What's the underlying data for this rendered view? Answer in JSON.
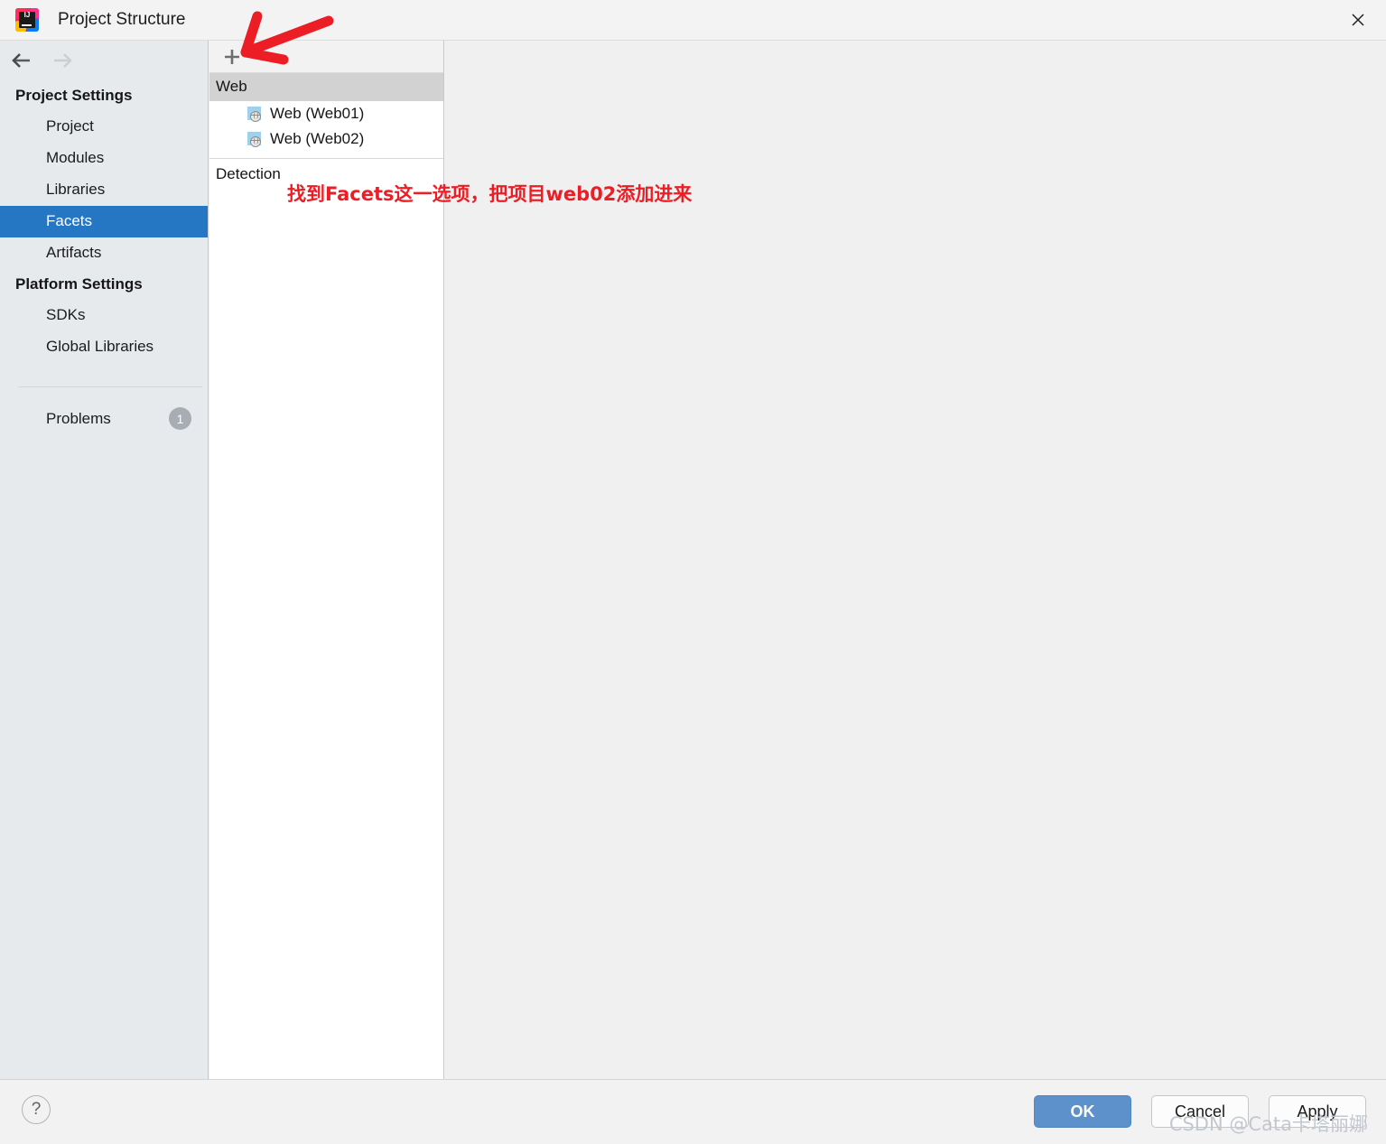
{
  "window": {
    "title": "Project Structure",
    "app_icon": "intellij-idea-icon",
    "icon_text": "IJ",
    "close_icon": "close-icon"
  },
  "nav": {
    "back_icon": "arrow-left-icon",
    "forward_icon": "arrow-right-icon"
  },
  "sidebar": {
    "sections": [
      {
        "title": "Project Settings",
        "items": [
          {
            "label": "Project",
            "selected": false
          },
          {
            "label": "Modules",
            "selected": false
          },
          {
            "label": "Libraries",
            "selected": false
          },
          {
            "label": "Facets",
            "selected": true
          },
          {
            "label": "Artifacts",
            "selected": false
          }
        ]
      },
      {
        "title": "Platform Settings",
        "items": [
          {
            "label": "SDKs",
            "selected": false
          },
          {
            "label": "Global Libraries",
            "selected": false
          }
        ]
      }
    ],
    "problems": {
      "label": "Problems",
      "count": "1"
    }
  },
  "tree_panel": {
    "toolbar": {
      "add_icon": "plus-icon",
      "add_label": "+"
    },
    "groups": [
      {
        "header": "Web",
        "header_style": "selected",
        "rows": [
          {
            "label": "Web (Web01)",
            "icon": "web-facet-icon"
          },
          {
            "label": "Web (Web02)",
            "icon": "web-facet-icon"
          }
        ]
      },
      {
        "header": "Detection",
        "header_style": "plain",
        "rows": []
      }
    ]
  },
  "annotations": {
    "arrow": "red-arrow-annotation",
    "text": "找到Facets这一选项，把项目web02添加进来",
    "color": "#ec1d24"
  },
  "footer": {
    "help_label": "?",
    "help_icon": "help-icon",
    "buttons": [
      {
        "label": "OK",
        "style": "primary"
      },
      {
        "label": "Cancel",
        "style": "normal"
      },
      {
        "label": "Apply",
        "style": "normal"
      }
    ]
  },
  "watermark": {
    "text": "CSDN @Cata卡塔丽娜"
  },
  "colors": {
    "accent_selected": "#2577c4",
    "primary_button": "#5c91cb",
    "annotation_red": "#ec1d24",
    "group_header": "#d2d2d2",
    "sidebar_bg": "#e7eaed"
  }
}
